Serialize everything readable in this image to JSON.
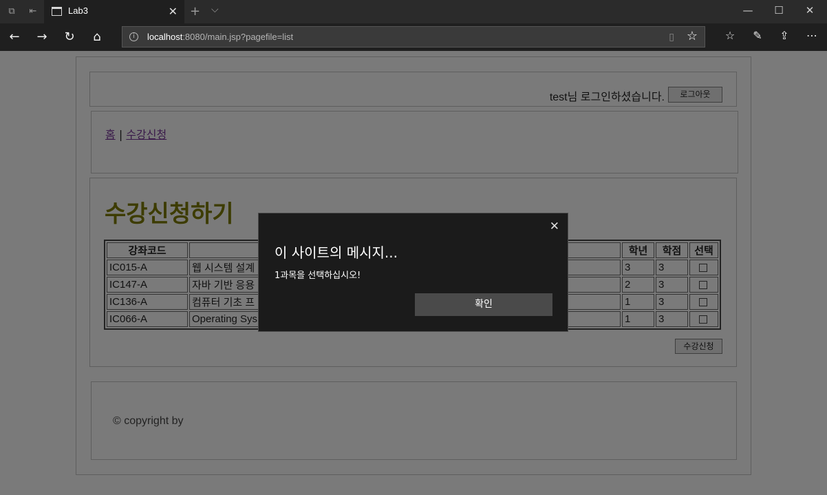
{
  "browser": {
    "tab_title": "Lab3",
    "url_host": "localhost",
    "url_rest": ":8080/main.jsp?pagefile=list"
  },
  "header": {
    "login_text": "test님 로그인하셨습니다.",
    "logout_label": "로그아웃"
  },
  "menu": {
    "home": "홈",
    "separator": "|",
    "enroll": "수강신청"
  },
  "main": {
    "heading": "수강신청하기",
    "columns": [
      "강좌코드",
      "",
      "학년",
      "학점",
      "선택"
    ],
    "rows": [
      {
        "code": "IC015-A",
        "name": "웹 시스템 설계",
        "year": "3",
        "credit": "3"
      },
      {
        "code": "IC147-A",
        "name": "자바 기반 응용",
        "year": "2",
        "credit": "3"
      },
      {
        "code": "IC136-A",
        "name": "컴퓨터 기초 프",
        "year": "1",
        "credit": "3"
      },
      {
        "code": "IC066-A",
        "name": "Operating Sys",
        "year": "1",
        "credit": "3"
      }
    ],
    "submit_label": "수강신청"
  },
  "footer": {
    "copyright": "© copyright by"
  },
  "dialog": {
    "title": "이 사이트의 메시지...",
    "message": "1과목을 선택하십시오!",
    "ok_label": "확인"
  }
}
